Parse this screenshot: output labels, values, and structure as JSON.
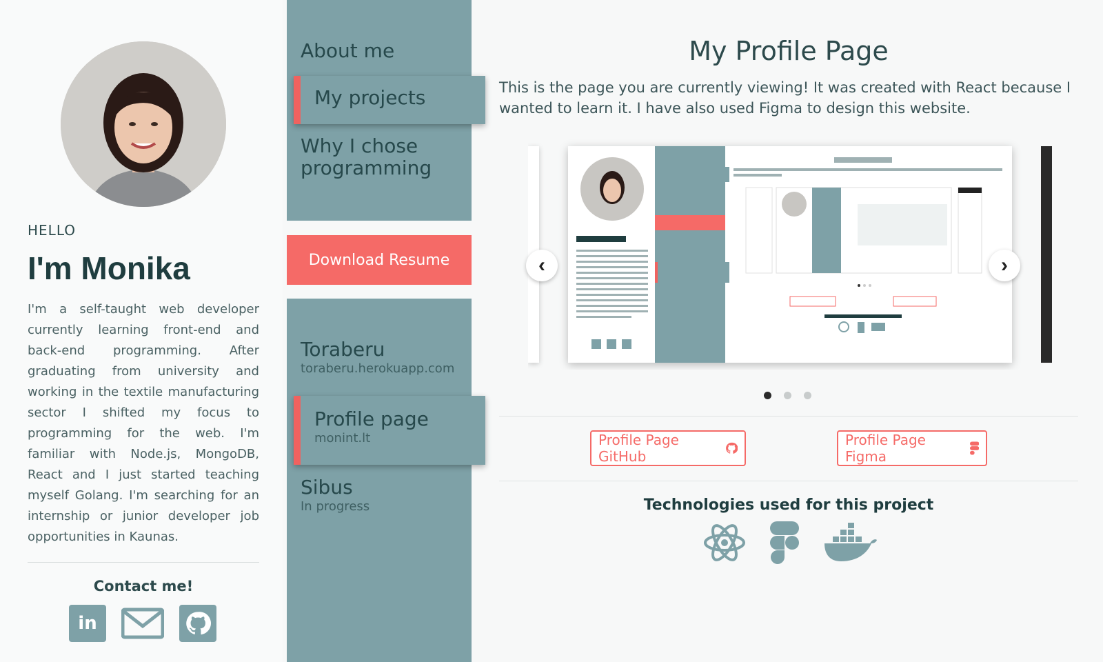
{
  "profile": {
    "greeting": "HELLO",
    "name": "I'm Monika",
    "bio": "I'm a self-taught web developer currently learning front-end and back-end programming. After graduating from university and working in the textile manufacturing sector I shifted my focus to programming for the web. I'm familiar with Node.js, MongoDB, React and I just started teaching myself Golang. I'm searching for an internship or junior developer job opportunities in Kaunas.",
    "contact_heading": "Contact me!",
    "socials": [
      {
        "icon": "linkedin-icon",
        "label": "in"
      },
      {
        "icon": "mail-icon"
      },
      {
        "icon": "github-icon"
      }
    ]
  },
  "nav": {
    "items": [
      {
        "label": "About me",
        "active": false
      },
      {
        "label": "My projects",
        "active": true
      },
      {
        "label": "Why I chose programming",
        "active": false
      }
    ]
  },
  "download_label": "Download Resume",
  "projects": [
    {
      "title": "Toraberu",
      "subtitle": "toraberu.herokuapp.com",
      "active": false
    },
    {
      "title": "Profile page",
      "subtitle": "monint.lt",
      "active": true
    },
    {
      "title": "Sibus",
      "subtitle": "In progress",
      "active": false
    }
  ],
  "project_detail": {
    "title": "My Profile Page",
    "description": "This is the page you are currently viewing! It was created with React because I wanted to learn it. I have also used Figma to design this website.",
    "carousel": {
      "slide_count": 3,
      "active_index": 0,
      "prev_icon": "chevron-left-icon",
      "next_icon": "chevron-right-icon"
    },
    "github_label": "Profile Page GitHub",
    "figma_label": "Profile Page Figma",
    "tech_heading": "Technologies used for this project",
    "technologies": [
      "react-icon",
      "figma-icon",
      "docker-icon"
    ]
  },
  "colors": {
    "accent": "#f56a67",
    "panel": "#7ea1a7",
    "dark": "#1f3d3f"
  }
}
